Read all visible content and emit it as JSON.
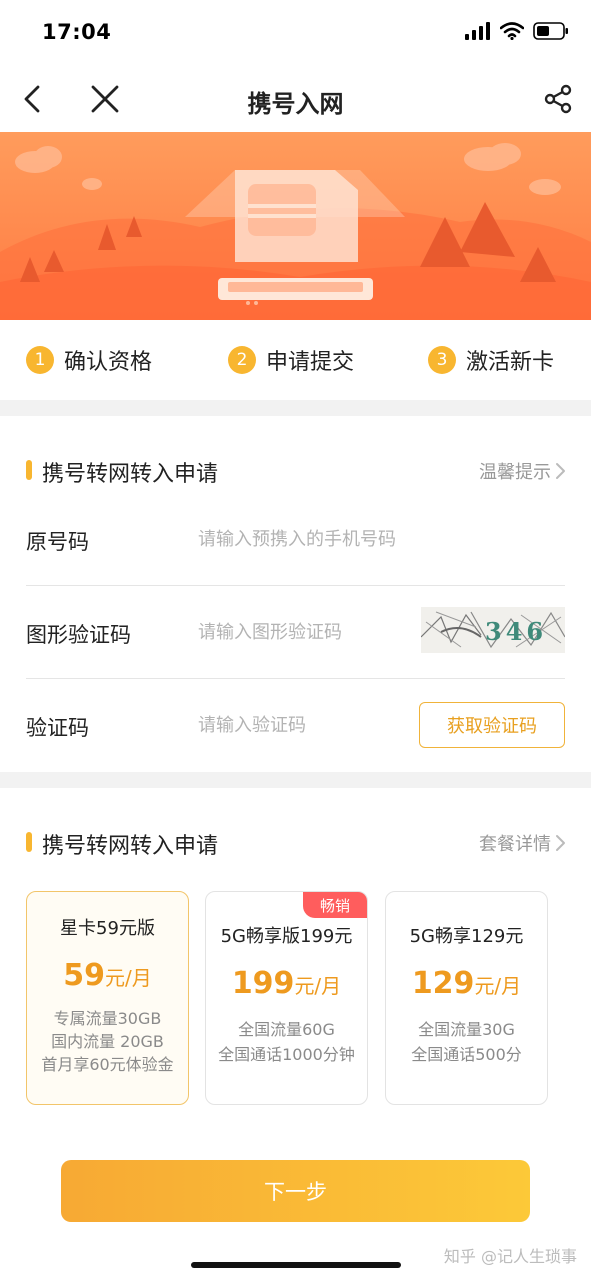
{
  "status_bar": {
    "time": "17:04"
  },
  "nav": {
    "title": "携号入网"
  },
  "steps": [
    {
      "num": "1",
      "label": "确认资格"
    },
    {
      "num": "2",
      "label": "申请提交"
    },
    {
      "num": "3",
      "label": "激活新卡"
    }
  ],
  "form_section": {
    "title": "携号转网转入申请",
    "link": "温馨提示",
    "rows": [
      {
        "label": "原号码",
        "placeholder": "请输入预携入的手机号码"
      },
      {
        "label": "图形验证码",
        "placeholder": "请输入图形验证码",
        "captcha_text": "346"
      },
      {
        "label": "验证码",
        "placeholder": "请输入验证码",
        "button": "获取验证码"
      }
    ]
  },
  "plan_section": {
    "title": "携号转网转入申请",
    "link": "套餐详情",
    "plans": [
      {
        "name": "星卡59元版",
        "price": "59",
        "unit": "元/月",
        "features": [
          "专属流量30GB",
          "国内流量 20GB",
          "首月享60元体验金"
        ],
        "selected": true
      },
      {
        "name": "5G畅享版199元",
        "price": "199",
        "unit": "元/月",
        "features": [
          "全国流量60G",
          "全国通话1000分钟"
        ],
        "badge": "畅销"
      },
      {
        "name": "5G畅享129元",
        "price": "129",
        "unit": "元/月",
        "features": [
          "全国流量30G",
          "全国通话500分"
        ]
      }
    ]
  },
  "next_button": "下一步",
  "watermark": "知乎 @记人生琐事",
  "colors": {
    "accent": "#f8b630",
    "price": "#ee9a1f",
    "banner": "#ff8a4c",
    "badge": "#ff5d5d"
  }
}
